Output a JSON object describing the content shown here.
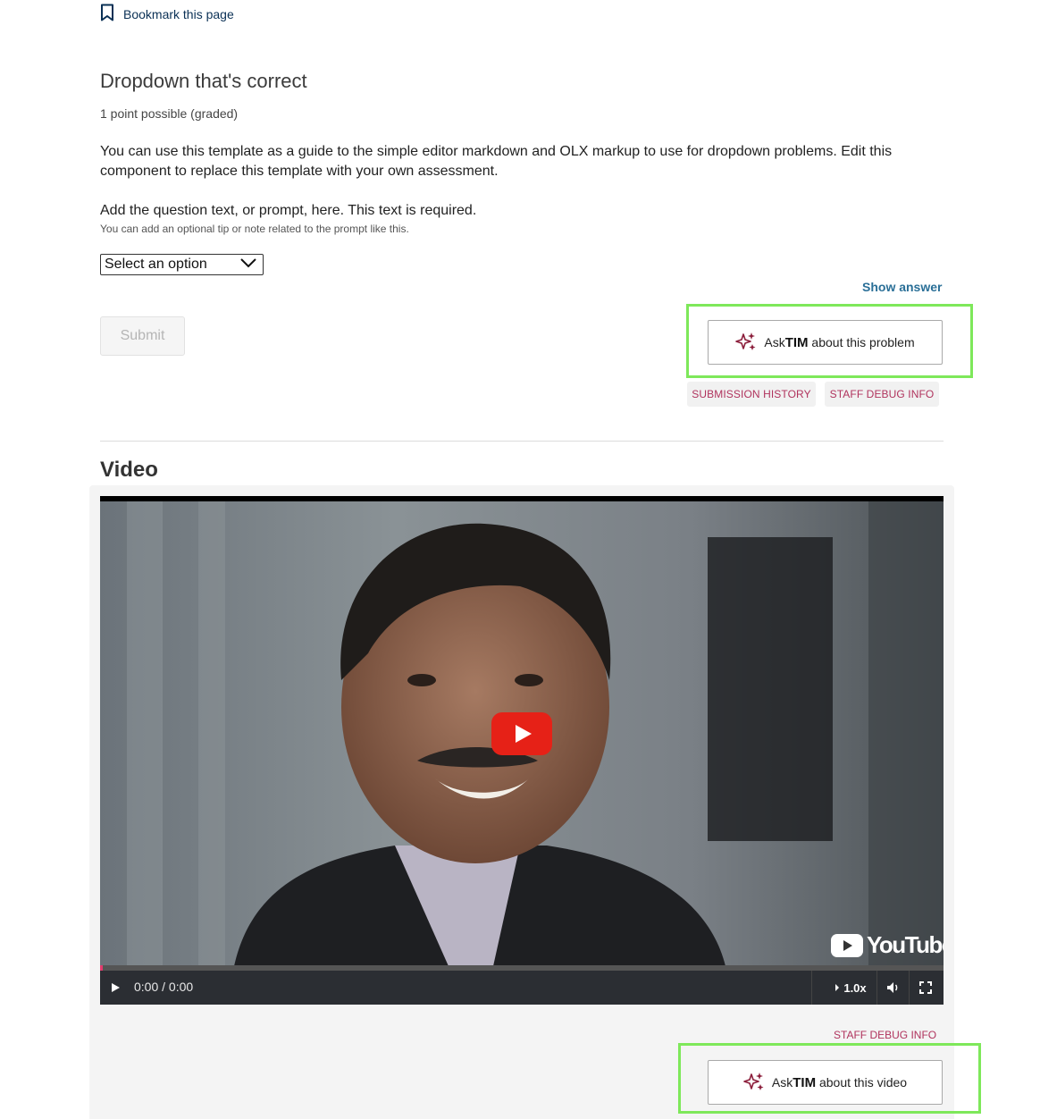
{
  "bookmark": {
    "label": "Bookmark this page",
    "icon": "bookmark-icon"
  },
  "problem": {
    "title": "Dropdown that's correct",
    "points": "1 point possible (graded)",
    "description": "You can use this template as a guide to the simple editor markdown and OLX markup to use for dropdown problems. Edit this component to replace this template with your own assessment.",
    "prompt": "Add the question text, or prompt, here. This text is required.",
    "tip": "You can add an optional tip or note related to the prompt like this.",
    "dropdown": {
      "selected": "Select an option"
    },
    "show_answer": "Show answer",
    "submit": "Submit",
    "asktim": {
      "prefix": "Ask",
      "brand": "TIM",
      "suffix": " about this problem"
    },
    "submission_history": "SUBMISSION HISTORY",
    "staff_debug": "STAFF DEBUG INFO"
  },
  "video": {
    "heading": "Video",
    "youtube_label": "YouTube",
    "time": "0:00 / 0:00",
    "speed": "1.0x",
    "progress": 0.003,
    "staff_debug": "STAFF DEBUG INFO",
    "asktim": {
      "prefix": "Ask",
      "brand": "TIM",
      "suffix": " about this video"
    }
  },
  "colors": {
    "accent_link": "#2a6f97",
    "debug_text": "#b0335d",
    "highlight": "#7ee85a",
    "sparkle": "#8b1d3a",
    "youtube_red": "#e62117"
  }
}
